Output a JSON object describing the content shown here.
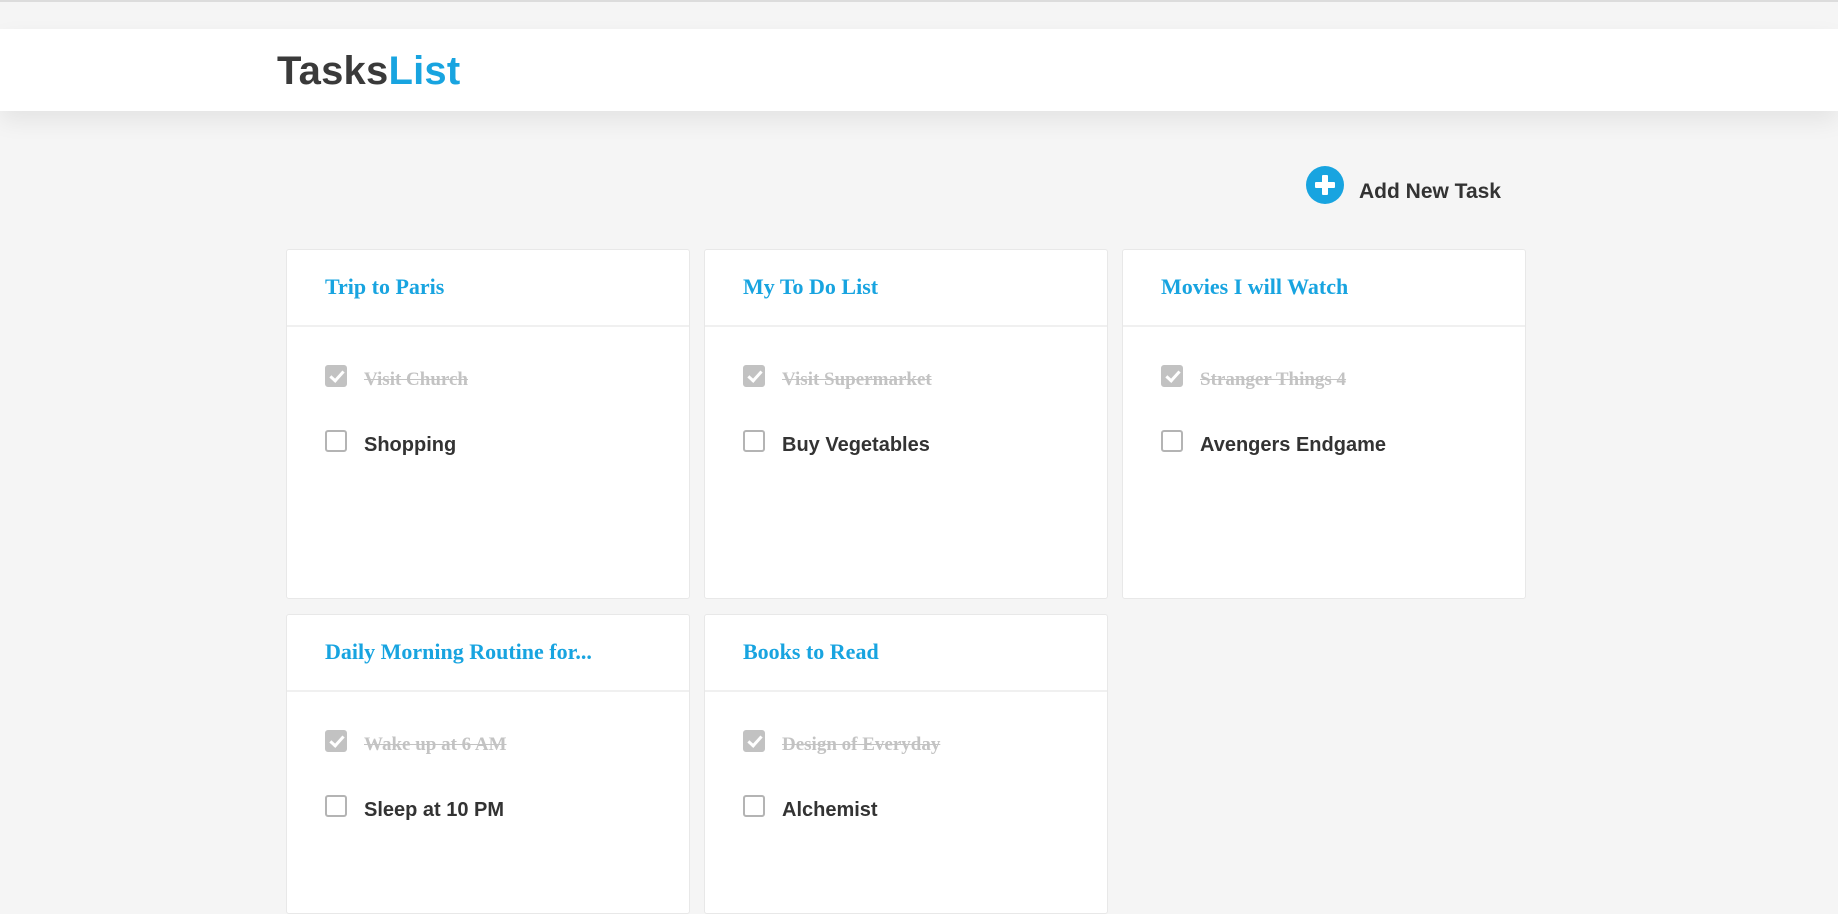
{
  "brand": {
    "part1": "Tasks",
    "part2": "List"
  },
  "actions": {
    "add_task_label": "Add New Task",
    "add_icon": "plus-circle-icon"
  },
  "colors": {
    "accent": "#18a4e0",
    "text": "#333333",
    "done_text": "#c3c3c3",
    "background": "#f5f5f5"
  },
  "cards": [
    {
      "title": "Trip to Paris",
      "tasks": [
        {
          "label": "Visit Church",
          "done": true
        },
        {
          "label": "Shopping",
          "done": false
        }
      ]
    },
    {
      "title": "My To Do List",
      "tasks": [
        {
          "label": "Visit Supermarket",
          "done": true
        },
        {
          "label": "Buy Vegetables",
          "done": false
        }
      ]
    },
    {
      "title": "Movies I will Watch",
      "tasks": [
        {
          "label": "Stranger Things 4",
          "done": true
        },
        {
          "label": "Avengers Endgame",
          "done": false
        }
      ]
    },
    {
      "title": "Daily Morning Routine for...",
      "tasks": [
        {
          "label": "Wake up at 6 AM",
          "done": true
        },
        {
          "label": "Sleep at 10 PM",
          "done": false
        }
      ]
    },
    {
      "title": "Books to Read",
      "tasks": [
        {
          "label": "Design of Everyday",
          "done": true
        },
        {
          "label": "Alchemist",
          "done": false
        }
      ]
    }
  ]
}
